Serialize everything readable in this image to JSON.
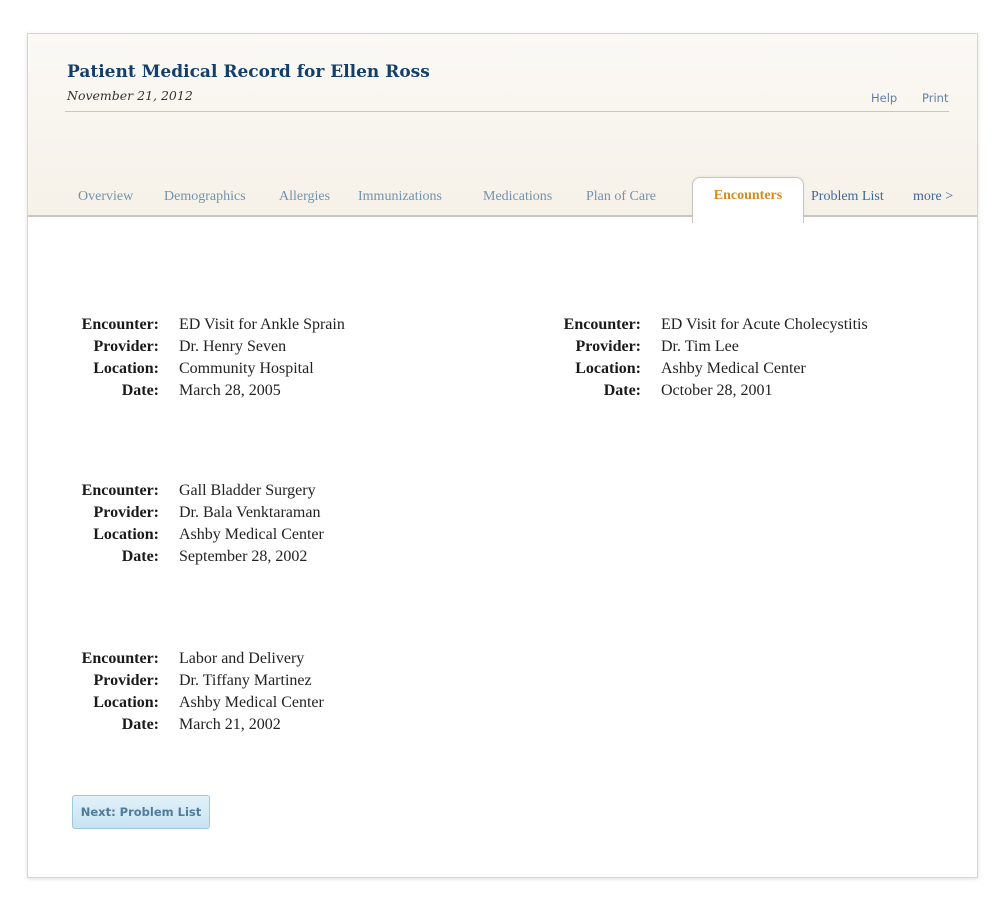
{
  "header": {
    "title": "Patient Medical Record for Ellen Ross",
    "date": "November 21, 2012",
    "help_label": "Help",
    "print_label": "Print"
  },
  "tabs": [
    {
      "label": "Overview"
    },
    {
      "label": "Demographics"
    },
    {
      "label": "Allergies"
    },
    {
      "label": "Immunizations"
    },
    {
      "label": "Medications"
    },
    {
      "label": "Plan of Care"
    },
    {
      "label": "Encounters",
      "active": true
    },
    {
      "label": "Problem List"
    },
    {
      "label": "more >"
    }
  ],
  "labels": {
    "encounter": "Encounter:",
    "provider": "Provider:",
    "location": "Location:",
    "date": "Date:"
  },
  "encounters": [
    {
      "encounter": "ED Visit for Ankle Sprain",
      "provider": "Dr. Henry Seven",
      "location": "Community Hospital",
      "date": "March 28, 2005"
    },
    {
      "encounter": "ED Visit for Acute Cholecystitis",
      "provider": "Dr. Tim Lee",
      "location": "Ashby Medical Center",
      "date": "October 28, 2001"
    },
    {
      "encounter": "Gall Bladder Surgery",
      "provider": "Dr. Bala Venktaraman",
      "location": "Ashby Medical Center",
      "date": "September 28, 2002"
    },
    {
      "encounter": "Labor and Delivery",
      "provider": "Dr. Tiffany Martinez",
      "location": "Ashby Medical Center",
      "date": "March 21, 2002"
    }
  ],
  "next_button_label": "Next: Problem List",
  "colors": {
    "title": "#143f6b",
    "active_tab": "#d68a1e",
    "tab": "#7592ad",
    "link": "#5f7fa6"
  }
}
